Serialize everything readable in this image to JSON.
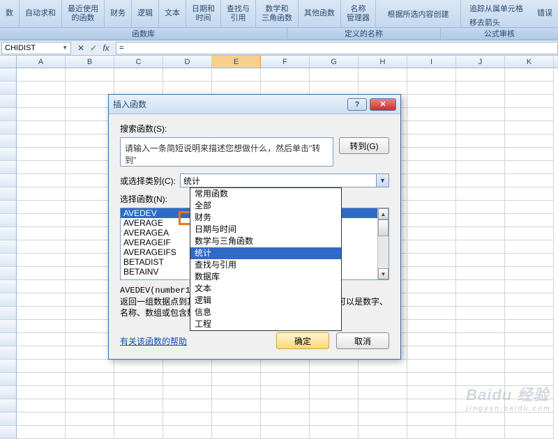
{
  "ribbon": {
    "groups": [
      {
        "l1": "数",
        "l2": ""
      },
      {
        "l1": "自动求和",
        "l2": ""
      },
      {
        "l1": "最近使用",
        "l2": "的函数"
      },
      {
        "l1": "财务",
        "l2": ""
      },
      {
        "l1": "逻辑",
        "l2": ""
      },
      {
        "l1": "文本",
        "l2": ""
      },
      {
        "l1": "日期和",
        "l2": "时间"
      },
      {
        "l1": "查找与",
        "l2": "引用"
      },
      {
        "l1": "数学和",
        "l2": "三角函数"
      },
      {
        "l1": "其他函数",
        "l2": ""
      }
    ],
    "name_group": {
      "l1": "名称",
      "l2": "管理器"
    },
    "define_name": "根据所选内容创建",
    "right": {
      "trace": "追踪从属单元格",
      "remove": "移去箭头",
      "error": "错误"
    },
    "section_labels": {
      "lib": "函数库",
      "names": "定义的名称",
      "audit": "公式审核"
    }
  },
  "namebox": {
    "value": "CHIDIST"
  },
  "formula_bar": {
    "cancel": "✕",
    "ok": "✓",
    "fx": "fx",
    "value": "="
  },
  "columns": [
    "A",
    "B",
    "C",
    "D",
    "E",
    "F",
    "G",
    "H",
    "I",
    "J",
    "K"
  ],
  "active_col_index": 4,
  "dialog": {
    "title": "插入函数",
    "help_btn": "?",
    "close_btn": "✕",
    "search_label": "搜索函数(S):",
    "search_value": "请输入一条简短说明来描述您想做什么，然后单击\"转到\"",
    "go_btn": "转到(G)",
    "category_label": "或选择类别(C):",
    "category_value": "统计",
    "dropdown_items": [
      "常用函数",
      "全部",
      "财务",
      "日期与时间",
      "数学与三角函数",
      "统计",
      "查找与引用",
      "数据库",
      "文本",
      "逻辑",
      "信息",
      "工程"
    ],
    "dropdown_hl_index": 5,
    "funclist_label": "选择函数(N):",
    "functions": [
      "AVEDEV",
      "AVERAGE",
      "AVERAGEA",
      "AVERAGEIF",
      "AVERAGEIFS",
      "BETADIST",
      "BETAINV"
    ],
    "func_sel_index": 0,
    "signature": "AVEDEV(number1,",
    "desc": "返回一组数据点到其算术平均值的绝对偏差的平均值。参数可以是数字、名称、数组或包含数字的引用",
    "help_link": "有关该函数的帮助",
    "ok": "确定",
    "cancel": "取消"
  },
  "watermark": {
    "brand": "Baidu 经验",
    "sub": "jingyan.baidu.com"
  }
}
